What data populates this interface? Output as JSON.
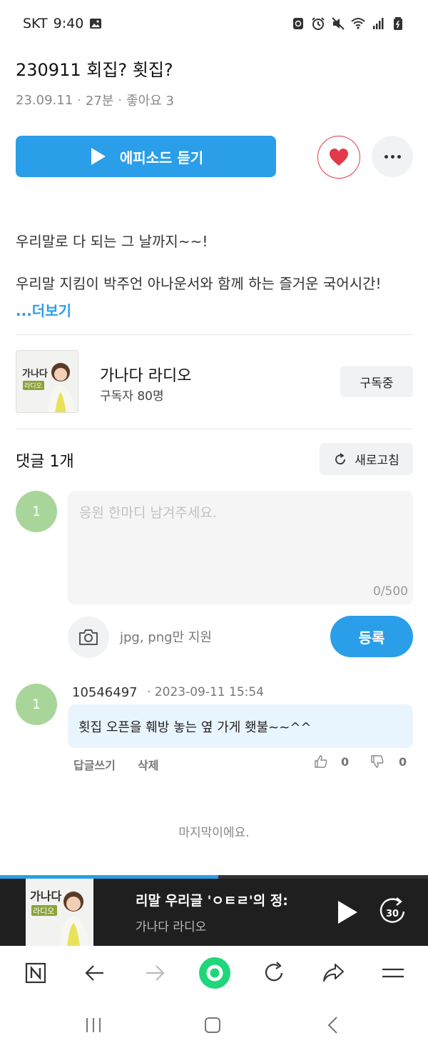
{
  "status": {
    "carrier": "SKT",
    "time": "9:40"
  },
  "episode": {
    "title": "230911 회집? 횟집?",
    "date": "23.09.11",
    "duration": "27분",
    "likes": "좋아요 3",
    "listen_label": "에피소드 듣기"
  },
  "description": {
    "line1": "우리말로 다 되는 그 날까지~~!",
    "line2": "우리말 지킴이 박주언 아나운서와 함께 하는 즐거운 국어시간!",
    "more": "...더보기"
  },
  "channel": {
    "name": "가나다 라디오",
    "subscribers": "구독자 80명",
    "subscribe_label": "구독중",
    "thumb_text_line1": "가나다",
    "thumb_text_line2": "라디오"
  },
  "comments": {
    "header": "댓글 1개",
    "refresh_label": "새로고침",
    "input_avatar": "1",
    "placeholder": "응원 한마디 남겨주세요.",
    "char_count": "0/500",
    "upload_hint": "jpg, png만 지원",
    "submit_label": "등록",
    "items": [
      {
        "avatar": "1",
        "user": "10546497",
        "date": "· 2023-09-11 15:54",
        "text": "횟집 오픈을 훼방 놓는 옆 가게 횃불~~^^",
        "reply_label": "답글쓰기",
        "delete_label": "삭제",
        "likes": "0",
        "dislikes": "0"
      }
    ],
    "end_text": "마지막이에요."
  },
  "player": {
    "progress": 0.51,
    "title": "리말 우리글 'ㅇㅌㄹ'의 정:",
    "channel": "가나다 라디오",
    "skip_label": "30"
  },
  "colors": {
    "accent": "#2a9ee8",
    "heart": "#e23a4a",
    "avatar": "#a8d59a",
    "browser_home": "#1fd67a"
  }
}
